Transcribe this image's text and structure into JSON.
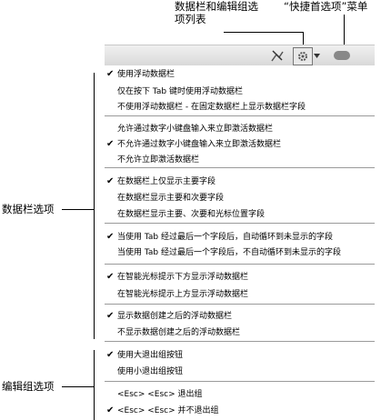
{
  "callouts": {
    "datasheet_list": [
      "数据栏和编辑组选",
      "项列表"
    ],
    "quick_prefs": "“快捷首选项”菜单",
    "datasheet_options": "数据栏选项",
    "edit_group_options": "编辑组选项"
  },
  "toolbar": {
    "icons": [
      "datasheet-crossed-icon",
      "gear-icon",
      "dropdown-arrow-icon",
      "menu-pill-icon"
    ]
  },
  "menu": {
    "items": [
      {
        "label": "使用浮动数据栏",
        "checked": true
      },
      {
        "label": "仅在按下 Tab 键时使用浮动数据栏",
        "checked": false
      },
      {
        "label": "不使用浮动数据栏 - 在固定数据栏上显示数据栏字段",
        "checked": false
      },
      {
        "label": "允许通过数字小键盘输入来立即激活数据栏",
        "checked": false
      },
      {
        "label": "不允许通过数字小键盘输入来立即激活数据栏",
        "checked": true
      },
      {
        "label": "不允许立即激活数据栏",
        "checked": false
      },
      {
        "label": "在数据栏上仅显示主要字段",
        "checked": true
      },
      {
        "label": "在数据栏显示主要和次要字段",
        "checked": false
      },
      {
        "label": "在数据栏显示主要、次要和光标位置字段",
        "checked": false
      },
      {
        "label": "当使用 Tab 经过最后一个字段后，自动循环到未显示的字段",
        "checked": true
      },
      {
        "label": "当使用 Tab 经过最后一个字段后，不自动循环到未显示的字段",
        "checked": false
      },
      {
        "label": "在智能光标提示下方显示浮动数据栏",
        "checked": true
      },
      {
        "label": "在智能光标提示上方显示浮动数据栏",
        "checked": false
      },
      {
        "label": "显示数据创建之后的浮动数据栏",
        "checked": true
      },
      {
        "label": "不显示数据创建之后的浮动数据栏",
        "checked": false
      },
      {
        "label": "使用大退出组按钮",
        "checked": true
      },
      {
        "label": "使用小退出组按钮",
        "checked": false
      },
      {
        "label": "<Esc> <Esc> 退出组",
        "checked": false
      },
      {
        "label": "<Esc> <Esc> 并不退出组",
        "checked": true
      }
    ]
  }
}
